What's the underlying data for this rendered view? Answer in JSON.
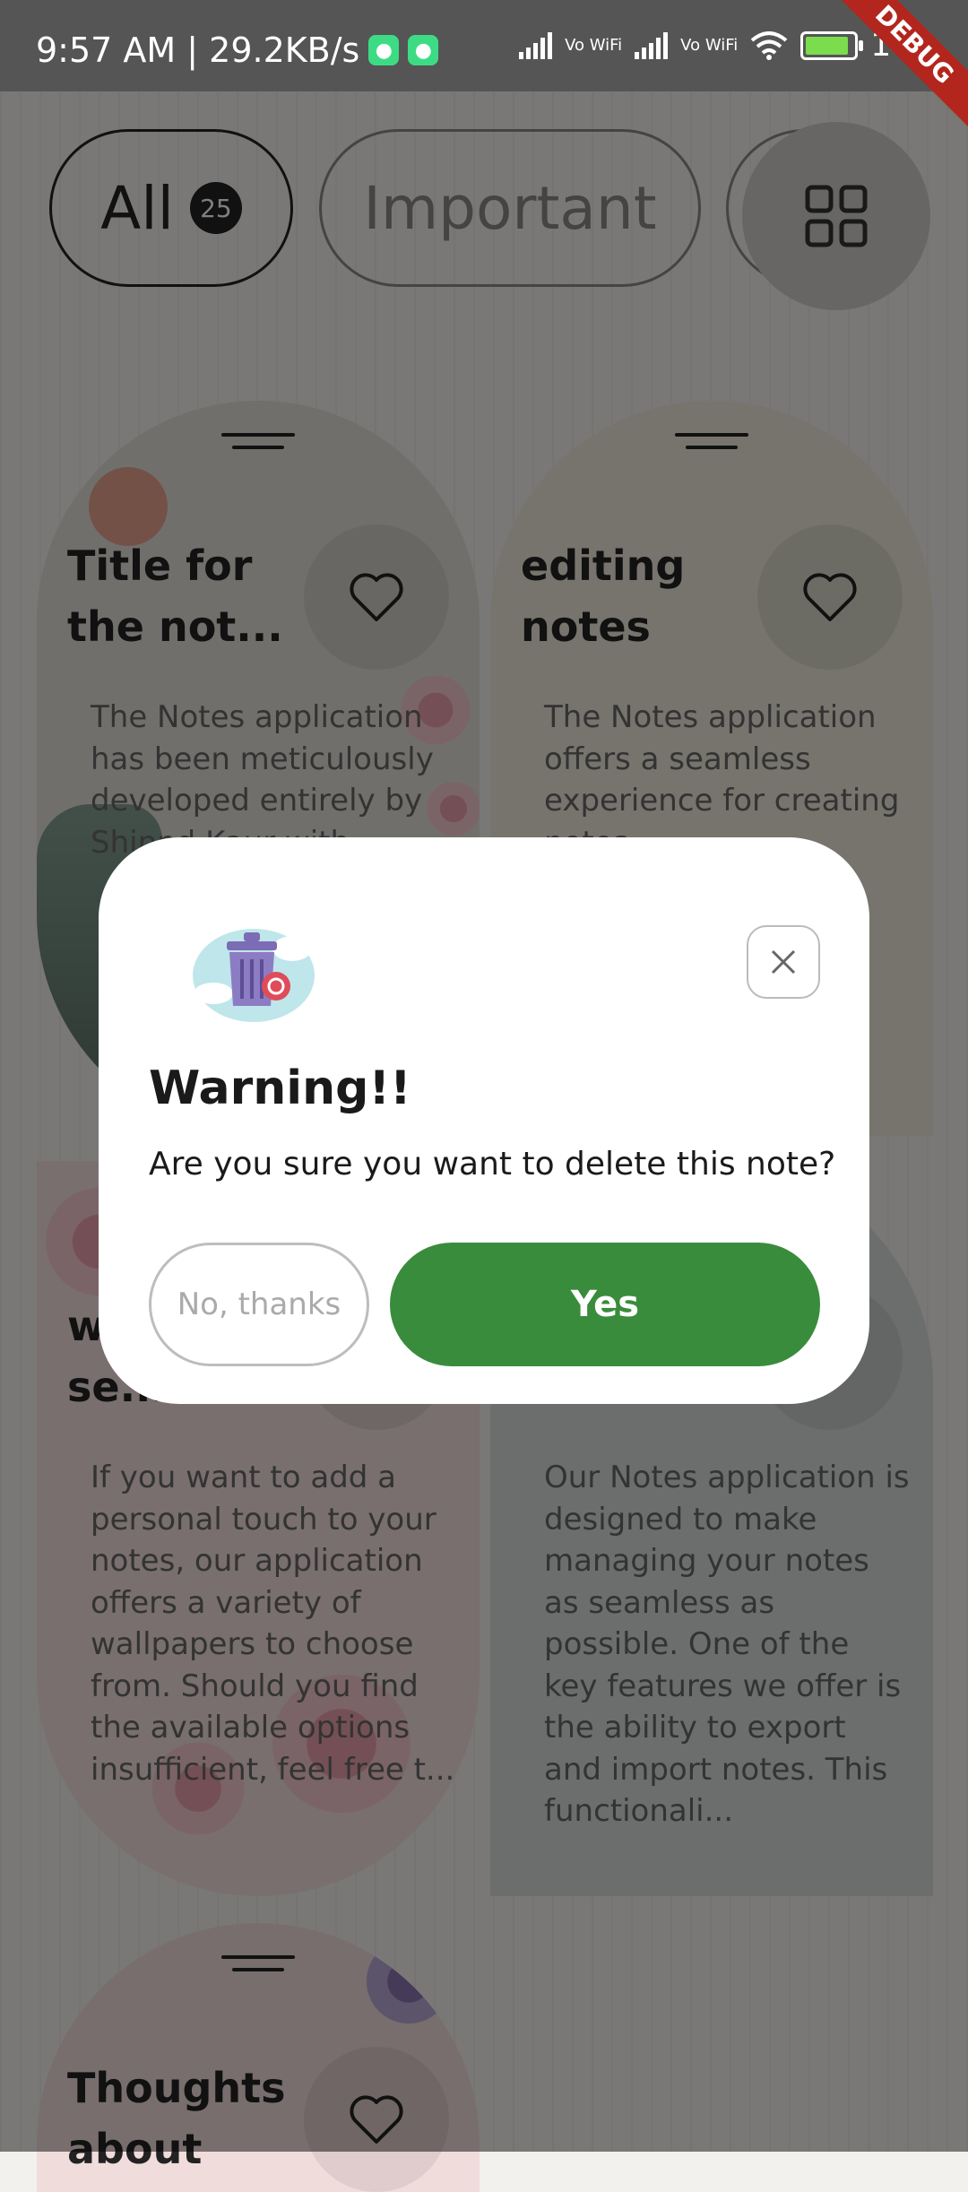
{
  "status_bar": {
    "time": "9:57 AM | 29.2KB/s",
    "vowifi_1": "Vo WiFi",
    "vowifi_2": "Vo WiFi",
    "battery_level": "100",
    "debug_banner": "DEBUG"
  },
  "filters": {
    "all_label": "All",
    "all_count": "25",
    "important_label": "Important",
    "layout_toggle_icon": "grid-icon"
  },
  "notes": [
    {
      "title": "Title for the not...",
      "body": "The Notes application has been meticulously developed entirely by Shinnd Kaur with..."
    },
    {
      "title": "editing notes",
      "body": "The Notes application offers a seamless experience for creating notes..."
    },
    {
      "title": "wallpaper se...",
      "body": "If you want to add a personal touch to your notes, our application offers a variety of wallpapers to choose from. Should you find the available options insufficient, feel free t..."
    },
    {
      "title": "",
      "body": "Our Notes application is designed to make managing your notes as seamless as possible. One of the key features we offer is the ability to export and import notes. This functionali..."
    },
    {
      "title": "Thoughts about",
      "body": ""
    }
  ],
  "dialog": {
    "title": "Warning!!",
    "message": "Are you sure you want to delete this note?",
    "cancel_label": "No, thanks",
    "confirm_label": "Yes",
    "close_icon": "close-icon",
    "illustration_icon": "trash-can-icon"
  },
  "colors": {
    "confirm_button": "#398c3b",
    "scrim": "rgba(0,0,0,0.5)",
    "debug_ribbon": "#b3261e"
  }
}
